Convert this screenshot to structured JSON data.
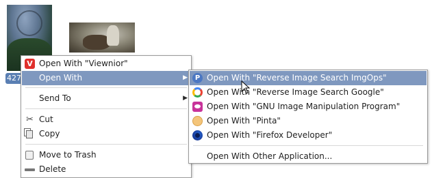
{
  "thumbnails": [
    {
      "label": "427",
      "selected": true
    },
    {
      "label": "",
      "selected": false
    }
  ],
  "context_menu": {
    "items": [
      {
        "label": "Open With \"Viewnior\"",
        "icon": "viewnior-icon"
      },
      {
        "label": "Open With",
        "icon": "",
        "submenu": true,
        "active": true
      },
      {
        "label": "Send To",
        "icon": "",
        "submenu": true
      },
      {
        "label": "Cut",
        "icon": "cut-icon"
      },
      {
        "label": "Copy",
        "icon": "copy-icon"
      },
      {
        "label": "Move to Trash",
        "icon": "trash-icon"
      },
      {
        "label": "Delete",
        "icon": "delete-icon"
      }
    ]
  },
  "open_with_submenu": {
    "items": [
      {
        "label": "Open With \"Reverse Image Search ImgOps\"",
        "icon": "imgops-icon",
        "active": true
      },
      {
        "label": "Open With \"Reverse Image Search Google\"",
        "icon": "google-icon"
      },
      {
        "label": "Open With \"GNU Image Manipulation Program\"",
        "icon": "gimp-icon"
      },
      {
        "label": "Open With \"Pinta\"",
        "icon": "pinta-icon"
      },
      {
        "label": "Open With \"Firefox Developer\"",
        "icon": "firefox-icon"
      },
      {
        "label": "Open With Other Application...",
        "icon": ""
      }
    ]
  },
  "colors": {
    "highlight": "#7f98bf",
    "selection_label": "#5a7fb3"
  }
}
